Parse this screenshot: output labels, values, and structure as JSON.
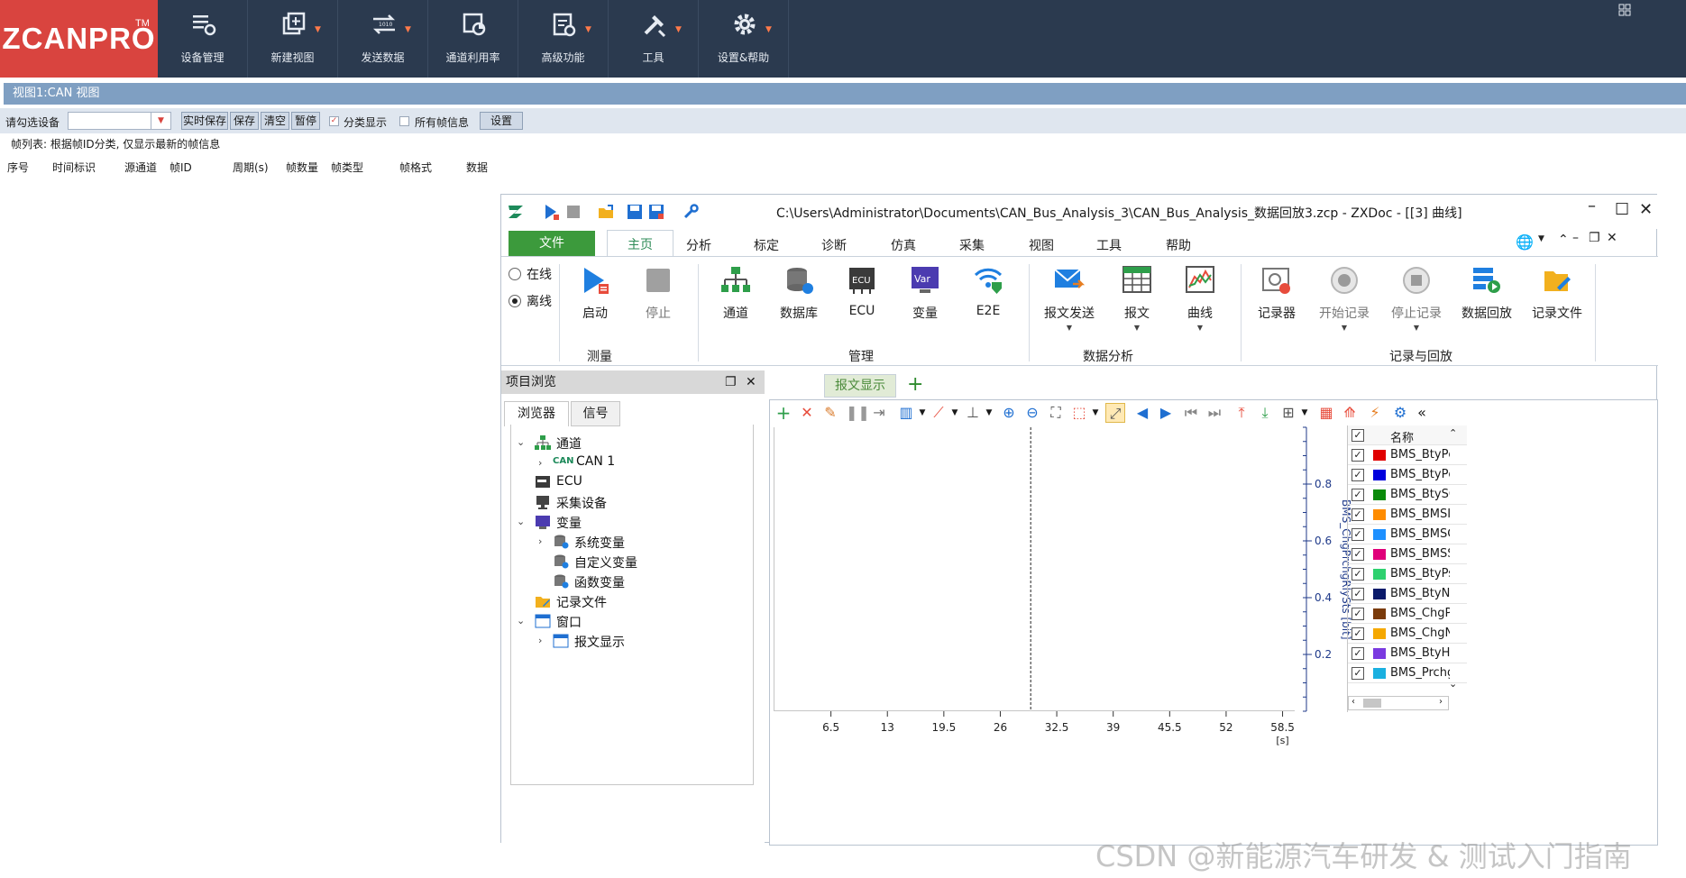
{
  "topbar": {
    "logo": "ZCANPRO",
    "logo_tm": "TM",
    "buttons": [
      {
        "label": "设备管理",
        "icon": "device-manage-icon"
      },
      {
        "label": "新建视图",
        "icon": "new-view-icon"
      },
      {
        "label": "发送数据",
        "icon": "send-data-icon"
      },
      {
        "label": "通道利用率",
        "icon": "channel-usage-icon"
      },
      {
        "label": "高级功能",
        "icon": "advanced-icon"
      },
      {
        "label": "工具",
        "icon": "tools-icon"
      },
      {
        "label": "设置&帮助",
        "icon": "settings-help-icon"
      }
    ]
  },
  "canview": {
    "tab_title": "视图1:CAN 视图",
    "select_device_label": "请勾选设备",
    "btn_realtime_save": "实时保存",
    "btn_save": "保存",
    "btn_clear": "清空",
    "btn_pause": "暂停",
    "chk_group_display": "分类显示",
    "chk_all_frames": "所有帧信息",
    "btn_settings": "设置",
    "hint": "帧列表: 根据帧ID分类, 仅显示最新的帧信息",
    "columns": [
      "序号",
      "时间标识",
      "源通道",
      "帧ID",
      "周期(s)",
      "帧数量",
      "帧类型",
      "帧格式",
      "数据"
    ]
  },
  "zxdoc": {
    "title": "C:\\Users\\Administrator\\Documents\\CAN_Bus_Analysis_3\\CAN_Bus_Analysis_数据回放3.zcp - ZXDoc - [[3] 曲线]",
    "file_tab": "文件",
    "ribbon_tabs": [
      "主页",
      "分析",
      "标定",
      "诊断",
      "仿真",
      "采集",
      "视图",
      "工具",
      "帮助"
    ],
    "online": "在线",
    "offline": "离线",
    "measure": {
      "start": "启动",
      "stop": "停止",
      "group": "测量"
    },
    "manage": {
      "channel": "通道",
      "database": "数据库",
      "ecu": "ECU",
      "variable": "变量",
      "e2e": "E2E",
      "group": "管理"
    },
    "analysis": {
      "msg_send": "报文发送",
      "msg": "报文",
      "curve": "曲线",
      "group": "数据分析"
    },
    "record": {
      "recorder": "记录器",
      "start_rec": "开始记录",
      "stop_rec": "停止记录",
      "replay": "数据回放",
      "rec_file": "记录文件",
      "group": "记录与回放"
    },
    "ecu_icon_text": "ECU",
    "var_icon_text": "Var"
  },
  "project": {
    "title": "项目浏览",
    "tab_browser": "浏览器",
    "tab_signal": "信号",
    "tree": {
      "channel": "通道",
      "can1": "CAN 1",
      "can_badge": "CAN",
      "ecu": "ECU",
      "acq_device": "采集设备",
      "variable": "变量",
      "sys_var": "系统变量",
      "custom_var": "自定义变量",
      "func_var": "函数变量",
      "rec_file": "记录文件",
      "window": "窗口",
      "msg_display": "报文显示"
    }
  },
  "chart_tab": "报文显示",
  "legend_header": "名称",
  "chart_data": {
    "type": "line",
    "title": "",
    "xlabel": "[s]",
    "ylabel": "BMS_ChgPrchgRlySts [bit]",
    "x_ticks": [
      6.5,
      13,
      19.5,
      26,
      32.5,
      39,
      45.5,
      52,
      58.5
    ],
    "y_ticks": [
      0.2,
      0.4,
      0.6,
      0.8
    ],
    "xlim": [
      0,
      60
    ],
    "ylim": [
      0,
      1
    ],
    "cursor_x": 29.5,
    "series": [
      {
        "name": "BMS_BtyPc",
        "color": "#e00000",
        "values": []
      },
      {
        "name": "BMS_BtyPc",
        "color": "#0000dd",
        "values": []
      },
      {
        "name": "BMS_BtySC",
        "color": "#0a8a0a",
        "values": []
      },
      {
        "name": "BMS_BMSI",
        "color": "#ff8c00",
        "values": []
      },
      {
        "name": "BMS_BMSC",
        "color": "#1e90ff",
        "values": []
      },
      {
        "name": "BMS_BMSS",
        "color": "#e0007a",
        "values": []
      },
      {
        "name": "BMS_BtyPs",
        "color": "#2ed16f",
        "values": []
      },
      {
        "name": "BMS_BtyN",
        "color": "#0a1a6a",
        "values": []
      },
      {
        "name": "BMS_ChgP",
        "color": "#7a3a0a",
        "values": []
      },
      {
        "name": "BMS_ChgN",
        "color": "#f5a800",
        "values": []
      },
      {
        "name": "BMS_BtyH",
        "color": "#7a3ae0",
        "values": []
      },
      {
        "name": "BMS_Prchg",
        "color": "#1ab0e0",
        "values": []
      }
    ]
  },
  "watermark": "CSDN @新能源汽车研发 & 测试入门指南"
}
